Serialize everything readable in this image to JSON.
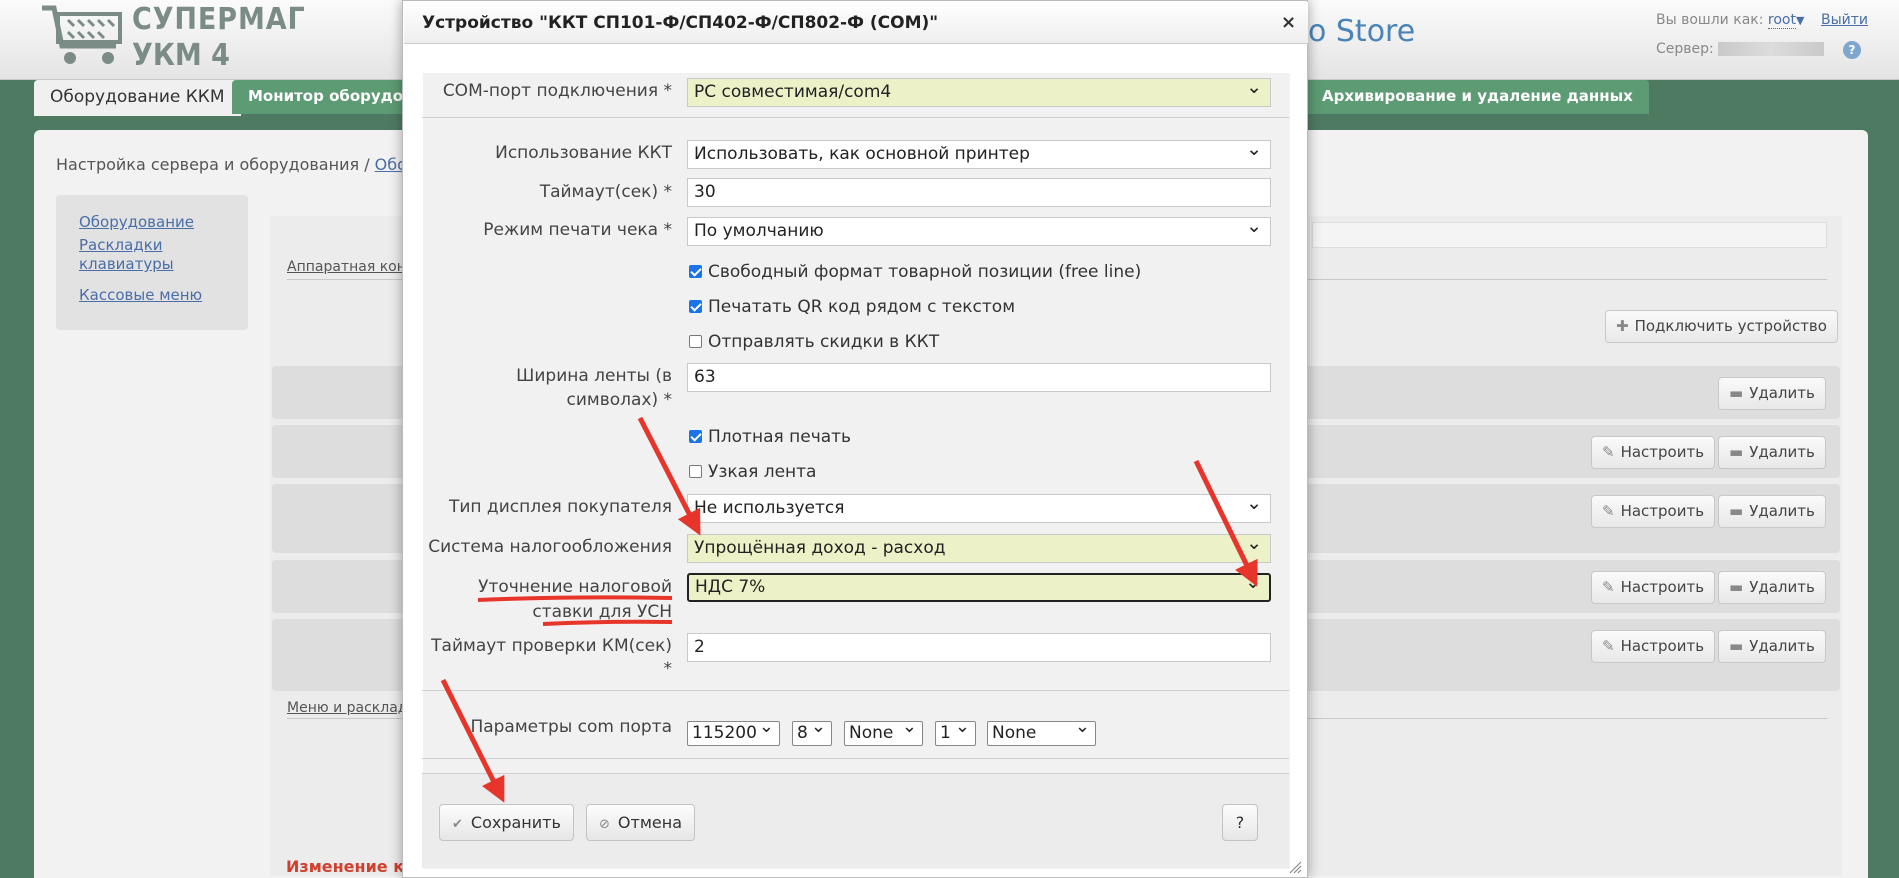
{
  "app": {
    "logo_line1": "СУПЕРМАГ",
    "logo_line2": "УКМ 4",
    "store_title": "o Store",
    "login_label": "Вы вошли как:",
    "login_user": "root",
    "logout": "Выйти",
    "server_label": "Сервер:",
    "help": "?"
  },
  "tabs": {
    "active": "Оборудование ККМ",
    "monitor": "Монитор оборудования",
    "archive": "Архивирование и удаление данных"
  },
  "breadcrumb": {
    "root": "Настройка сервера и оборудования",
    "sep": "/",
    "current": "Оборуд"
  },
  "side_menu": {
    "items": [
      "Оборудование",
      "Раскладки клавиатуры",
      "Кассовые меню"
    ]
  },
  "content": {
    "section_hw": "Аппаратная конф",
    "section_menu": "Меню и расклад",
    "add_device": "Подключить устройство",
    "configure": "Настроить",
    "delete": "Удалить",
    "warning": "Изменение кон"
  },
  "modal": {
    "title": "Устройство \"ККТ СП101-Ф/СП402-Ф/СП802-Ф (COM)\"",
    "close": "×",
    "fields": {
      "com_port_label": "COM-порт подключения *",
      "com_port_value": "PC совместимая/com4",
      "usage_label": "Использование ККТ",
      "usage_value": "Использовать, как основной принтер",
      "timeout_label": "Таймаут(сек) *",
      "timeout_value": "30",
      "print_mode_label": "Режим печати чека *",
      "print_mode_value": "По умолчанию",
      "free_line": "Свободный формат товарной позиции (free line)",
      "print_qr": "Печатать QR код рядом с текстом",
      "send_discounts": "Отправлять скидки в ККТ",
      "tape_width_label_1": "Ширина ленты (в",
      "tape_width_label_2": "символах) *",
      "tape_width_value": "63",
      "dense_print": "Плотная печать",
      "narrow_tape": "Узкая лента",
      "display_label": "Тип дисплея покупателя",
      "display_value": "Не используется",
      "tax_system_label": "Система налогообложения",
      "tax_system_value": "Упрощённая доход - расход",
      "tax_rate_label_1": "Уточнение налоговой",
      "tax_rate_label_2": "ставки для УСН",
      "tax_rate_value": "НДС 7%",
      "km_timeout_label_1": "Таймаут проверки КМ(сек)",
      "km_timeout_label_2": "*",
      "km_timeout_value": "2",
      "com_params_label": "Параметры com порта",
      "baud": "115200",
      "data_bits": "8",
      "parity": "None",
      "stop_bits": "1",
      "flow": "None"
    },
    "checks": {
      "free_line": true,
      "print_qr": true,
      "send_discounts": false,
      "dense_print": true,
      "narrow_tape": false
    },
    "buttons": {
      "save": "Сохранить",
      "cancel": "Отмена",
      "help": "?"
    }
  },
  "colors": {
    "annotation_red": "#e8352b",
    "highlight_field": "#ecf1c8",
    "tab_green": "#5c9b74",
    "page_bg": "#4f7a62"
  },
  "icons": [
    "cart-logo-icon",
    "chevron-down-icon",
    "plus-icon",
    "pencil-icon",
    "minus-icon",
    "check-icon",
    "cancel-icon",
    "close-icon",
    "resize-grip-icon"
  ]
}
